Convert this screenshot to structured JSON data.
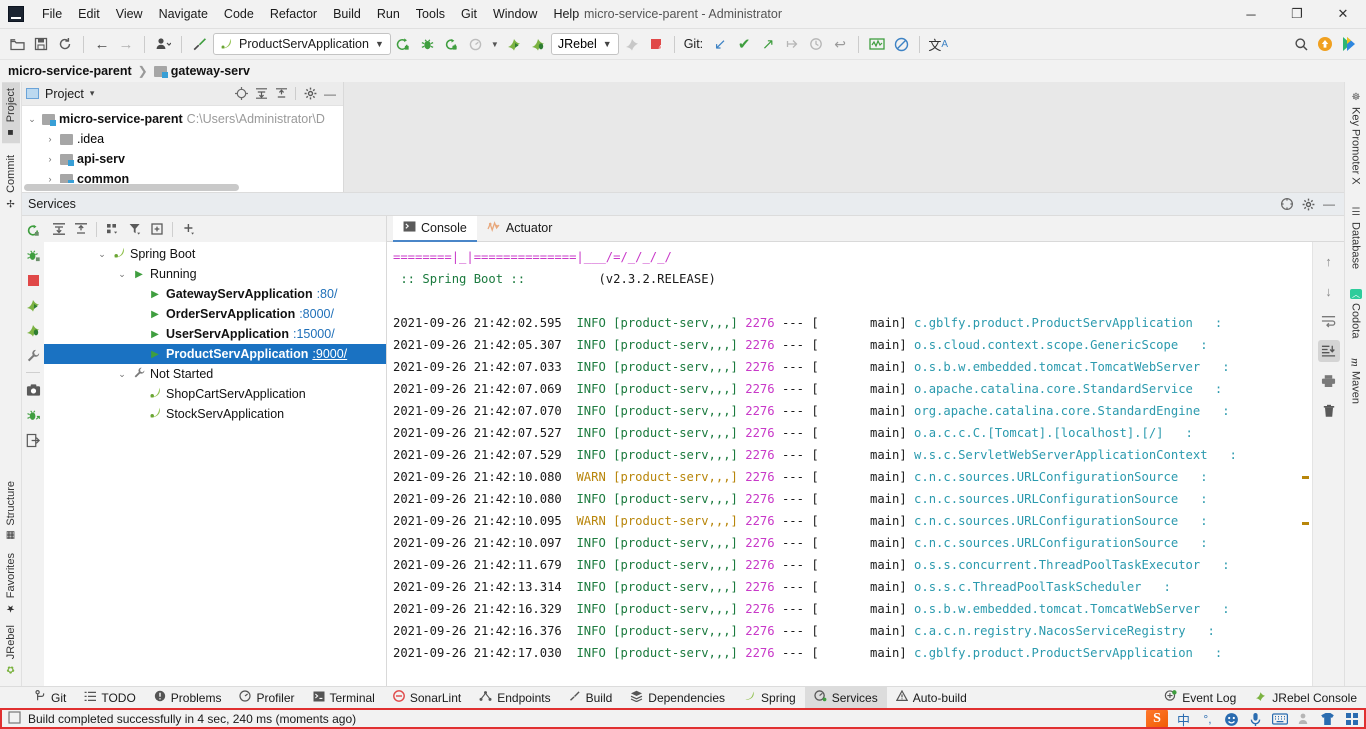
{
  "window": {
    "title": "micro-service-parent - Administrator",
    "logo_text": "IJ",
    "controls": {
      "minimize": "─",
      "maximize": "❐",
      "close": "✕"
    }
  },
  "menubar": {
    "items": [
      "File",
      "Edit",
      "View",
      "Navigate",
      "Code",
      "Refactor",
      "Build",
      "Run",
      "Tools",
      "Git",
      "Window",
      "Help"
    ]
  },
  "toolbar": {
    "open_label": "open-folder-icon",
    "save_label": "save-icon",
    "sync_label": "sync-icon",
    "back_label": "←",
    "forward_label": "→",
    "profile_label": "user-profile-icon",
    "build_label": "build-hammer-icon",
    "run_config": "ProductServApplication",
    "run_label": "run-icon",
    "debug_label": "debug-icon",
    "run_coverage_label": "run-coverage-icon",
    "profiler_label": "profiler-icon",
    "jrebel_run_label": "jrebel-run-icon",
    "jrebel_debug_label": "jrebel-debug-icon",
    "jrebel_select": "JRebel",
    "git_label": "Git:",
    "git_update": "↙",
    "git_commit": "✔",
    "git_push": "↗",
    "git_rollback": "⟲",
    "git_history": "◷",
    "git_revert": "↩",
    "search_label": "search-icon",
    "update_label": "update-icon",
    "ide_label": "ide-icon"
  },
  "breadcrumb": {
    "root": "micro-service-parent",
    "separator": "❯",
    "current": "gateway-serv"
  },
  "left_strip": {
    "tabs": [
      "Project",
      "Commit",
      "Structure",
      "Favorites",
      "JRebel"
    ],
    "active": "Project"
  },
  "right_strip": {
    "tabs": [
      "Key Promoter X",
      "Database",
      "Codota",
      "Maven"
    ]
  },
  "project_panel": {
    "title": "Project",
    "dropdown": "▾",
    "actions": [
      "locate-icon",
      "expand-all-icon",
      "collapse-all-icon",
      "settings-gear-icon",
      "hide-icon"
    ],
    "tree": [
      {
        "depth": 0,
        "arrow": "⌄",
        "label": "micro-service-parent",
        "path": "C:\\Users\\Administrator\\D",
        "bold": true
      },
      {
        "depth": 1,
        "arrow": "›",
        "label": ".idea",
        "path": "",
        "bold": false
      },
      {
        "depth": 1,
        "arrow": "›",
        "label": "api-serv",
        "path": "",
        "bold": true
      },
      {
        "depth": 1,
        "arrow": "›",
        "label": "common",
        "path": "",
        "bold": true
      }
    ]
  },
  "services": {
    "title": "Services",
    "header_actions": [
      "help-icon",
      "settings-gear-icon",
      "hide-icon"
    ],
    "rail_icons": [
      "rerun-icon",
      "debug-icon",
      "stop-icon",
      "jrebel-run-icon",
      "jrebel-debug-icon",
      "wrench-icon",
      "camera-icon",
      "attach-icon",
      "exit-icon"
    ],
    "toolbar_icons": [
      "expand-all-icon",
      "collapse-all-icon",
      "group-icon",
      "filter-icon",
      "add-frame-icon",
      "add-icon"
    ],
    "tree": [
      {
        "depth": 0,
        "arrow": "⌄",
        "icon": "spring-leaf-icon",
        "label": "Spring Boot",
        "port": "",
        "bold": false,
        "selected": false
      },
      {
        "depth": 1,
        "arrow": "⌄",
        "icon": "run-triangle-icon",
        "label": "Running",
        "port": "",
        "bold": false,
        "selected": false
      },
      {
        "depth": 2,
        "arrow": "",
        "icon": "run-triangle-icon",
        "label": "GatewayServApplication",
        "port": ":80/",
        "bold": true,
        "selected": false
      },
      {
        "depth": 2,
        "arrow": "",
        "icon": "run-triangle-icon",
        "label": "OrderServApplication",
        "port": ":8000/",
        "bold": true,
        "selected": false
      },
      {
        "depth": 2,
        "arrow": "",
        "icon": "run-triangle-icon",
        "label": "UserServApplication",
        "port": ":15000/",
        "bold": true,
        "selected": false
      },
      {
        "depth": 2,
        "arrow": "",
        "icon": "run-triangle-icon",
        "label": "ProductServApplication",
        "port": ":9000/",
        "bold": true,
        "selected": true
      },
      {
        "depth": 1,
        "arrow": "⌄",
        "icon": "wrench-icon",
        "label": "Not Started",
        "port": "",
        "bold": false,
        "selected": false
      },
      {
        "depth": 2,
        "arrow": "",
        "icon": "spring-leaf-icon",
        "label": "ShopCartServApplication",
        "port": "",
        "bold": false,
        "selected": false
      },
      {
        "depth": 2,
        "arrow": "",
        "icon": "spring-leaf-icon",
        "label": "StockServApplication",
        "port": "",
        "bold": false,
        "selected": false
      }
    ]
  },
  "console": {
    "tabs": [
      {
        "label": "Console",
        "icon": "console-icon",
        "active": true
      },
      {
        "label": "Actuator",
        "icon": "actuator-icon",
        "active": false
      }
    ],
    "right_actions": [
      "scroll-up-icon",
      "scroll-down-icon",
      "soft-wrap-icon",
      "scroll-to-end-icon",
      "print-icon",
      "trash-icon"
    ],
    "banner": {
      "ascii": "========|_|==============|___/=/_/_/_/",
      "name": ":: Spring Boot ::",
      "version": "(v2.3.2.RELEASE)"
    },
    "log_columns": {
      "pid": "2276",
      "app": "[product-serv,,,]",
      "dashes": "---",
      "thread": "main]"
    },
    "log_lines": [
      {
        "time": "2021-09-26 21:42:02.595",
        "level": "INFO",
        "logger": "c.gblfy.product.ProductServApplication"
      },
      {
        "time": "2021-09-26 21:42:05.307",
        "level": "INFO",
        "logger": "o.s.cloud.context.scope.GenericScope"
      },
      {
        "time": "2021-09-26 21:42:07.033",
        "level": "INFO",
        "logger": "o.s.b.w.embedded.tomcat.TomcatWebServer"
      },
      {
        "time": "2021-09-26 21:42:07.069",
        "level": "INFO",
        "logger": "o.apache.catalina.core.StandardService"
      },
      {
        "time": "2021-09-26 21:42:07.070",
        "level": "INFO",
        "logger": "org.apache.catalina.core.StandardEngine"
      },
      {
        "time": "2021-09-26 21:42:07.527",
        "level": "INFO",
        "logger": "o.a.c.c.C.[Tomcat].[localhost].[/]"
      },
      {
        "time": "2021-09-26 21:42:07.529",
        "level": "INFO",
        "logger": "w.s.c.ServletWebServerApplicationContext"
      },
      {
        "time": "2021-09-26 21:42:10.080",
        "level": "WARN",
        "logger": "c.n.c.sources.URLConfigurationSource"
      },
      {
        "time": "2021-09-26 21:42:10.080",
        "level": "INFO",
        "logger": "c.n.c.sources.URLConfigurationSource"
      },
      {
        "time": "2021-09-26 21:42:10.095",
        "level": "WARN",
        "logger": "c.n.c.sources.URLConfigurationSource"
      },
      {
        "time": "2021-09-26 21:42:10.097",
        "level": "INFO",
        "logger": "c.n.c.sources.URLConfigurationSource"
      },
      {
        "time": "2021-09-26 21:42:11.679",
        "level": "INFO",
        "logger": "o.s.s.concurrent.ThreadPoolTaskExecutor"
      },
      {
        "time": "2021-09-26 21:42:13.314",
        "level": "INFO",
        "logger": "o.s.s.c.ThreadPoolTaskScheduler"
      },
      {
        "time": "2021-09-26 21:42:16.329",
        "level": "INFO",
        "logger": "o.s.b.w.embedded.tomcat.TomcatWebServer"
      },
      {
        "time": "2021-09-26 21:42:16.376",
        "level": "INFO",
        "logger": "c.a.c.n.registry.NacosServiceRegistry"
      },
      {
        "time": "2021-09-26 21:42:17.030",
        "level": "INFO",
        "logger": "c.gblfy.product.ProductServApplication"
      }
    ]
  },
  "bottom_bar": {
    "items": [
      {
        "label": "Git",
        "icon": "git-branch-icon",
        "active": false
      },
      {
        "label": "TODO",
        "icon": "todo-list-icon",
        "active": false
      },
      {
        "label": "Problems",
        "icon": "problems-icon",
        "active": false
      },
      {
        "label": "Profiler",
        "icon": "profiler-icon",
        "active": false
      },
      {
        "label": "Terminal",
        "icon": "terminal-icon",
        "active": false
      },
      {
        "label": "SonarLint",
        "icon": "sonarlint-icon",
        "active": false
      },
      {
        "label": "Endpoints",
        "icon": "endpoints-icon",
        "active": false
      },
      {
        "label": "Build",
        "icon": "build-hammer-icon",
        "active": false
      },
      {
        "label": "Dependencies",
        "icon": "dependencies-icon",
        "active": false
      },
      {
        "label": "Spring",
        "icon": "spring-leaf-icon",
        "active": false
      },
      {
        "label": "Services",
        "icon": "services-icon",
        "active": true
      },
      {
        "label": "Auto-build",
        "icon": "warning-icon",
        "active": false
      }
    ],
    "right_items": [
      {
        "label": "Event Log",
        "icon": "event-log-icon"
      },
      {
        "label": "JRebel Console",
        "icon": "jrebel-icon"
      }
    ]
  },
  "statusbar": {
    "icon": "build-status-icon",
    "message": "Build completed successfully in 4 sec, 240 ms (moments ago)",
    "tray": [
      "sogou-icon",
      "chinese-mode",
      "punctuation-icon",
      "emoji-icon",
      "mic-icon",
      "keyboard-icon",
      "user-icon",
      "skin-icon",
      "apps-icon"
    ]
  },
  "colors": {
    "selection": "#1a72c2",
    "accent_green": "#3f9e3f",
    "log_info": "#1b7a3e",
    "log_warn": "#b8860b",
    "log_pid": "#c838c8",
    "log_logger": "#2b9aae",
    "link": "#1e6fb8"
  }
}
